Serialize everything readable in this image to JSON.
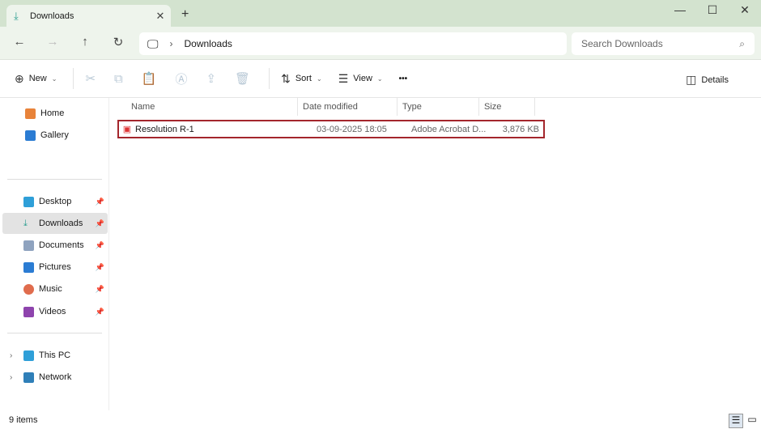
{
  "window": {
    "tab_title": "Downloads",
    "new_tab": "+",
    "minimize": "—",
    "maximize": "☐",
    "close": "✕"
  },
  "nav": {
    "path_root_icon": "computer-icon",
    "breadcrumb": [
      "Downloads"
    ],
    "search_placeholder": "Search Downloads"
  },
  "toolbar": {
    "new_label": "New",
    "sort_label": "Sort",
    "view_label": "View",
    "more": "•••",
    "details_label": "Details"
  },
  "sidebar": {
    "top": [
      {
        "label": "Home",
        "color": "#e8833a"
      },
      {
        "label": "Gallery",
        "color": "#2b7cd3"
      }
    ],
    "pinned": [
      {
        "label": "Desktop",
        "color": "#2f9fd8"
      },
      {
        "label": "Downloads",
        "color": "#2a9d8f",
        "selected": true
      },
      {
        "label": "Documents",
        "color": "#8fa3bf"
      },
      {
        "label": "Pictures",
        "color": "#2b7cd3"
      },
      {
        "label": "Music",
        "color": "#e06c4d"
      },
      {
        "label": "Videos",
        "color": "#8e44ad"
      }
    ],
    "bottom": [
      {
        "label": "This PC",
        "color": "#2f9fd8"
      },
      {
        "label": "Network",
        "color": "#2f7fb8"
      }
    ]
  },
  "columns": [
    "Name",
    "Date modified",
    "Type",
    "Size"
  ],
  "files": [
    {
      "name": "Resolution R-1",
      "date": "03-09-2025 18:05",
      "type": "Adobe Acrobat D...",
      "size": "3,876 KB",
      "icon": "pdf-icon"
    }
  ],
  "status": {
    "items": "9 items"
  },
  "colors": {
    "selection_border": "#a4262c",
    "titlebar": "#d3e3cf",
    "accent": "#2a9d8f"
  }
}
